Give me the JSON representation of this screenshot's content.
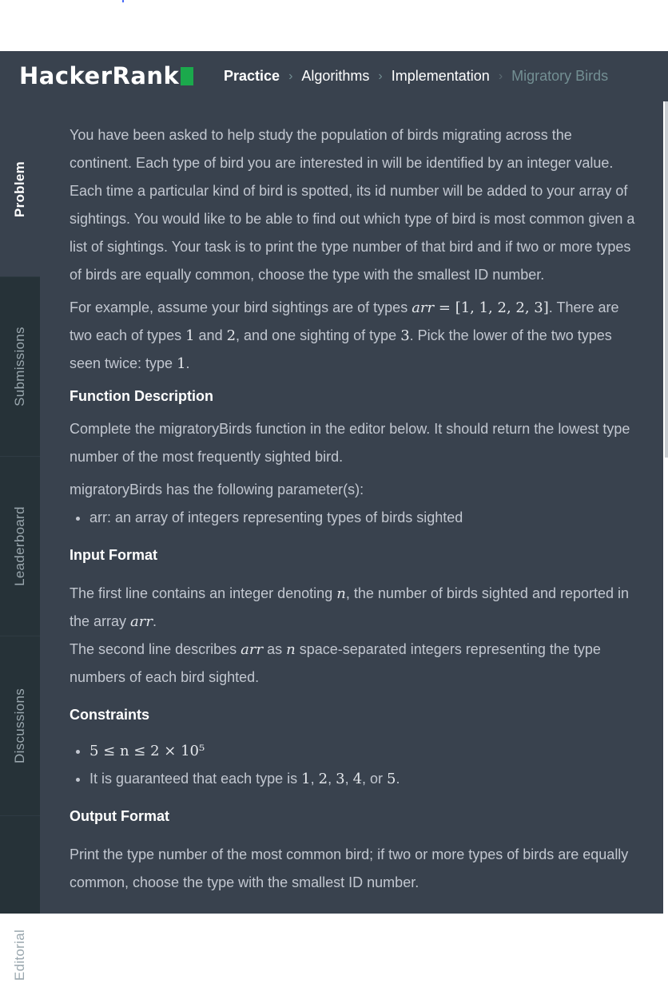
{
  "navbar": {
    "logo_text": "HackerRank",
    "breadcrumbs": [
      "Practice",
      "Algorithms",
      "Implementation",
      "Migratory Birds"
    ],
    "brand_color": "#1ba94c"
  },
  "sidebar": {
    "tabs": [
      "Problem",
      "Submissions",
      "Leaderboard",
      "Discussions",
      "Editorial"
    ],
    "active": "Problem"
  },
  "problem": {
    "intro": "You have been asked to help study the population of birds migrating across the continent. Each type of bird you are interested in will be identified by an integer value. Each time a particular kind of bird is spotted, its id number will be added to your array of sightings. You would like to be able to find out which type of bird is most common given a list of sightings. Your task is to print the type number of that bird and if two or more types of birds are equally common, choose the type with the smallest ID number.",
    "example": {
      "t1": "For example, assume your bird sightings are of types ",
      "arr_var": "arr",
      "eq": " = ",
      "arr_val": "[1, 1, 2, 2, 3]",
      "t2": ". There are two each of types ",
      "one": "1",
      "and": " and ",
      "two": "2",
      "t3": ", and one sighting of type ",
      "three": "3",
      "t4": ". Pick the lower of the two types seen twice: type ",
      "ans": "1",
      "t5": "."
    },
    "function_description": {
      "heading": "Function Description",
      "text": "Complete the migratoryBirds function in the editor below. It should return the lowest type number of the most frequently sighted bird.",
      "params_intro": "migratoryBirds has the following parameter(s):",
      "params": [
        "arr: an array of integers representing types of birds sighted"
      ]
    },
    "input_format": {
      "heading": "Input Format",
      "l1a": "The first line contains an integer denoting ",
      "n": "n",
      "l1b": ", the number of birds sighted and reported in the array ",
      "arr": "arr",
      "l1c": ".",
      "l2a": "The second line describes ",
      "l2arr": "arr",
      "l2b": " as ",
      "l2n": "n",
      "l2c": " space-separated integers representing the type numbers of each bird sighted."
    },
    "constraints": {
      "heading": "Constraints",
      "c1": "5 ≤ n ≤ 2 × 10⁵",
      "c2a": "It is guaranteed that each type is ",
      "v1": "1",
      "v2": "2",
      "v3": "3",
      "v4": "4",
      "v5": "5",
      "comma": ", ",
      "or": ", or ",
      "dot": "."
    },
    "output_format": {
      "heading": "Output Format",
      "text": "Print the type number of the most common bird; if two or more types of birds are equally common, choose the type with the smallest ID number."
    }
  }
}
